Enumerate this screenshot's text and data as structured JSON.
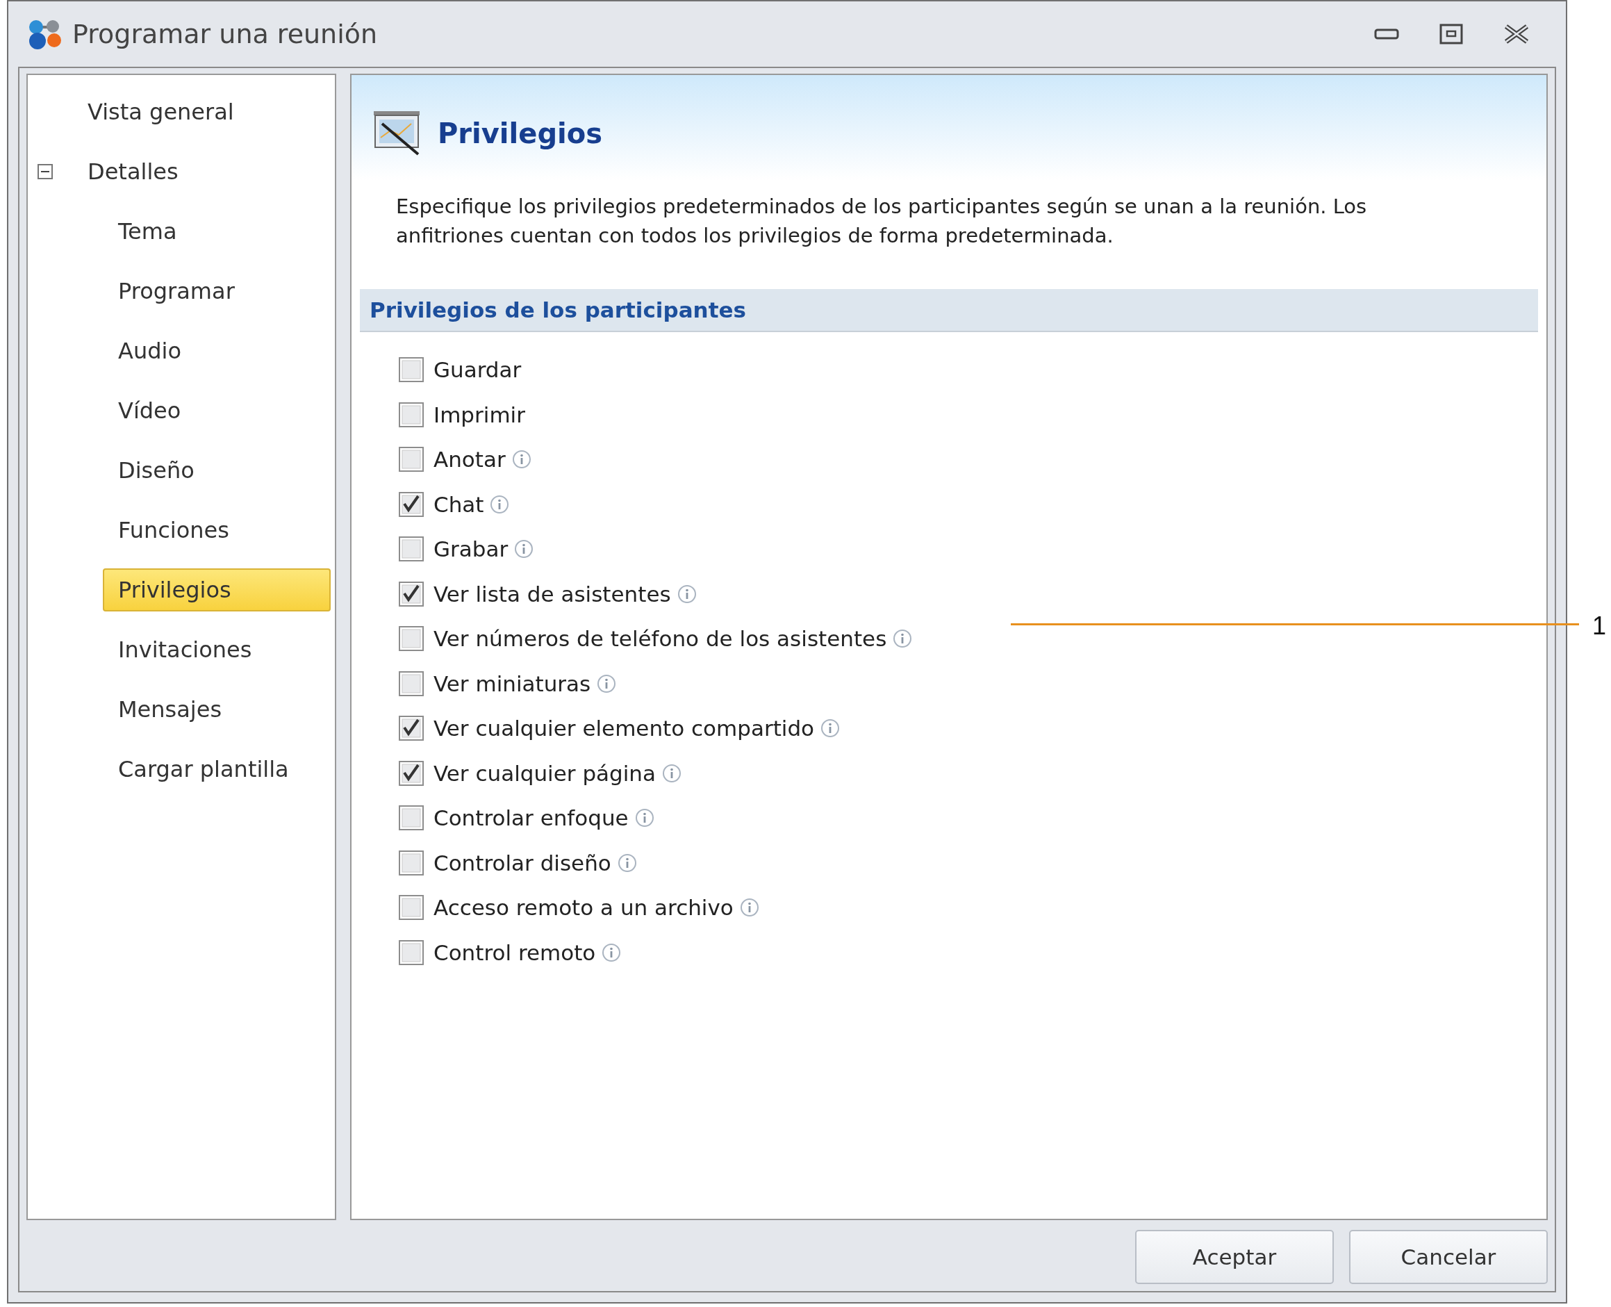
{
  "window": {
    "title": "Programar una reunión"
  },
  "sidebar": {
    "items": [
      {
        "label": "Vista general",
        "selected": false
      },
      {
        "label": "Detalles",
        "selected": false,
        "expanded": true,
        "children": [
          {
            "label": "Tema",
            "selected": false
          },
          {
            "label": "Programar",
            "selected": false
          },
          {
            "label": "Audio",
            "selected": false
          },
          {
            "label": "Vídeo",
            "selected": false
          },
          {
            "label": "Diseño",
            "selected": false
          },
          {
            "label": "Funciones",
            "selected": false
          },
          {
            "label": "Privilegios",
            "selected": true
          },
          {
            "label": "Invitaciones",
            "selected": false
          },
          {
            "label": "Mensajes",
            "selected": false
          },
          {
            "label": "Cargar plantilla",
            "selected": false
          }
        ]
      }
    ]
  },
  "page": {
    "title": "Privilegios",
    "description": "Especifique los privilegios predeterminados de los participantes según se unan a la reunión. Los anfitriones cuentan con todos los privilegios de forma predeterminada.",
    "section": "Privilegios de los participantes",
    "privileges": [
      {
        "label": "Guardar",
        "checked": false,
        "info": false
      },
      {
        "label": "Imprimir",
        "checked": false,
        "info": false
      },
      {
        "label": "Anotar",
        "checked": false,
        "info": true
      },
      {
        "label": "Chat",
        "checked": true,
        "info": true
      },
      {
        "label": "Grabar",
        "checked": false,
        "info": true
      },
      {
        "label": "Ver lista de asistentes",
        "checked": true,
        "info": true
      },
      {
        "label": "Ver números de teléfono de los asistentes",
        "checked": false,
        "info": true
      },
      {
        "label": "Ver miniaturas",
        "checked": false,
        "info": true
      },
      {
        "label": "Ver cualquier elemento compartido",
        "checked": true,
        "info": true
      },
      {
        "label": "Ver cualquier página",
        "checked": true,
        "info": true
      },
      {
        "label": "Controlar enfoque",
        "checked": false,
        "info": true
      },
      {
        "label": "Controlar diseño",
        "checked": false,
        "info": true
      },
      {
        "label": "Acceso remoto a un archivo",
        "checked": false,
        "info": true
      },
      {
        "label": "Control remoto",
        "checked": false,
        "info": true
      }
    ]
  },
  "buttons": [
    "Aceptar",
    "Cancelar"
  ],
  "callout": {
    "label": "1"
  }
}
